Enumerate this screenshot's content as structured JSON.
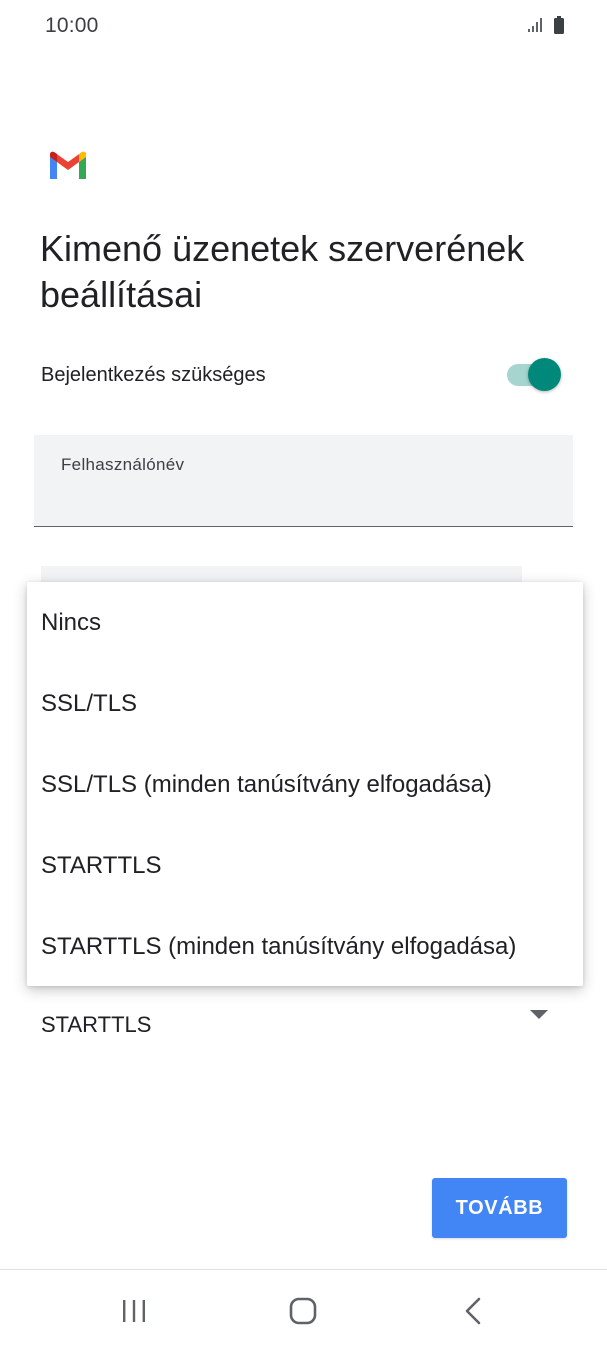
{
  "status_bar": {
    "time": "10:00",
    "signal_icon": "signal-bars-icon",
    "battery_icon": "battery-icon"
  },
  "app": {
    "logo_icon": "gmail-logo-icon",
    "brand_colors": {
      "red": "#EA4335",
      "blue": "#4285F4",
      "green": "#34A853",
      "yellow": "#FBBC04"
    }
  },
  "page": {
    "title": "Kimenő üzenetek szerverének beállításai"
  },
  "login_required": {
    "label": "Bejelentkezés szükséges",
    "enabled": true,
    "accent_color": "#00897B"
  },
  "username_field": {
    "label": "Felhasználónév",
    "value": ""
  },
  "security_type": {
    "selected": "STARTTLS",
    "caret_icon": "dropdown-arrow-icon",
    "menu_open": true,
    "options": [
      {
        "label": "Nincs"
      },
      {
        "label": "SSL/TLS"
      },
      {
        "label": "SSL/TLS (minden tanúsítvány elfogadása)"
      },
      {
        "label": "STARTTLS"
      },
      {
        "label": "STARTTLS (minden tanúsítvány elfogadása)"
      }
    ]
  },
  "actions": {
    "next_label": "TOVÁBB",
    "next_color": "#4285F4"
  },
  "nav_bar": {
    "recents_icon": "recent-apps-icon",
    "home_icon": "home-icon",
    "back_icon": "back-icon"
  }
}
